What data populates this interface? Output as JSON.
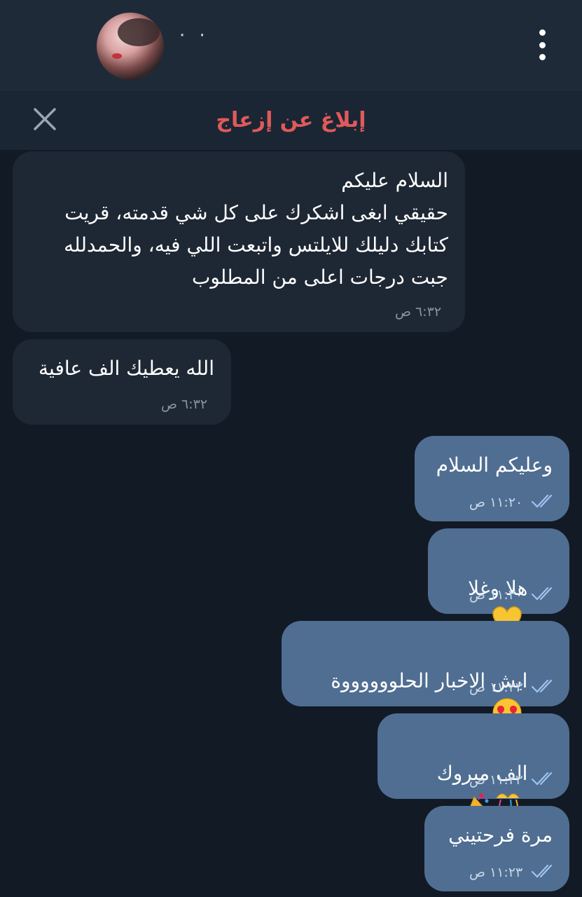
{
  "header": {
    "status": "· ·",
    "avatar_icon": "contact-avatar",
    "menu_icon": "more-vertical-icon"
  },
  "report_bar": {
    "label": "إبلاغ عن إزعاج",
    "close_icon": "close-icon",
    "label_color": "#e05a5a"
  },
  "messages": [
    {
      "direction": "incoming",
      "lines": [
        "السلام عليكم",
        "حقيقي ابغى اشكرك على كل شي قدمته، قريت",
        "كتابك دليلك للايلتس واتبعت اللي فيه، والحمدلله",
        "جبت درجات اعلى من المطلوب"
      ],
      "time": "٦:٣٢ ص"
    },
    {
      "direction": "incoming",
      "text": "الله يعطيك الف عافية",
      "time": "٦:٣٢ ص"
    },
    {
      "direction": "outgoing",
      "text": "وعليكم السلام",
      "time": "١١:٢٠ ص",
      "read": true
    },
    {
      "direction": "outgoing",
      "text": "هلا وغلا",
      "emoji": "yellow-heart-icon",
      "time": "١١:٢٠ ص",
      "read": true
    },
    {
      "direction": "outgoing",
      "text": "ايش الاخبار الحلووووووة",
      "emoji": "heart-eyes-icon",
      "time": "١١:٢٣ ص",
      "read": true
    },
    {
      "direction": "outgoing",
      "text": "الف مبروك",
      "emoji": "party-popper-and-ribbon-icon",
      "time": "١١:٢٣ ص",
      "read": true
    },
    {
      "direction": "outgoing",
      "text": "مرة فرحتيني",
      "time": "١١:٢٣ ص",
      "read": true
    }
  ],
  "colors": {
    "background": "#121a26",
    "incoming_bubble": "#1e2734",
    "outgoing_bubble": "#4f6e92",
    "tick": "#9fc4f0"
  }
}
